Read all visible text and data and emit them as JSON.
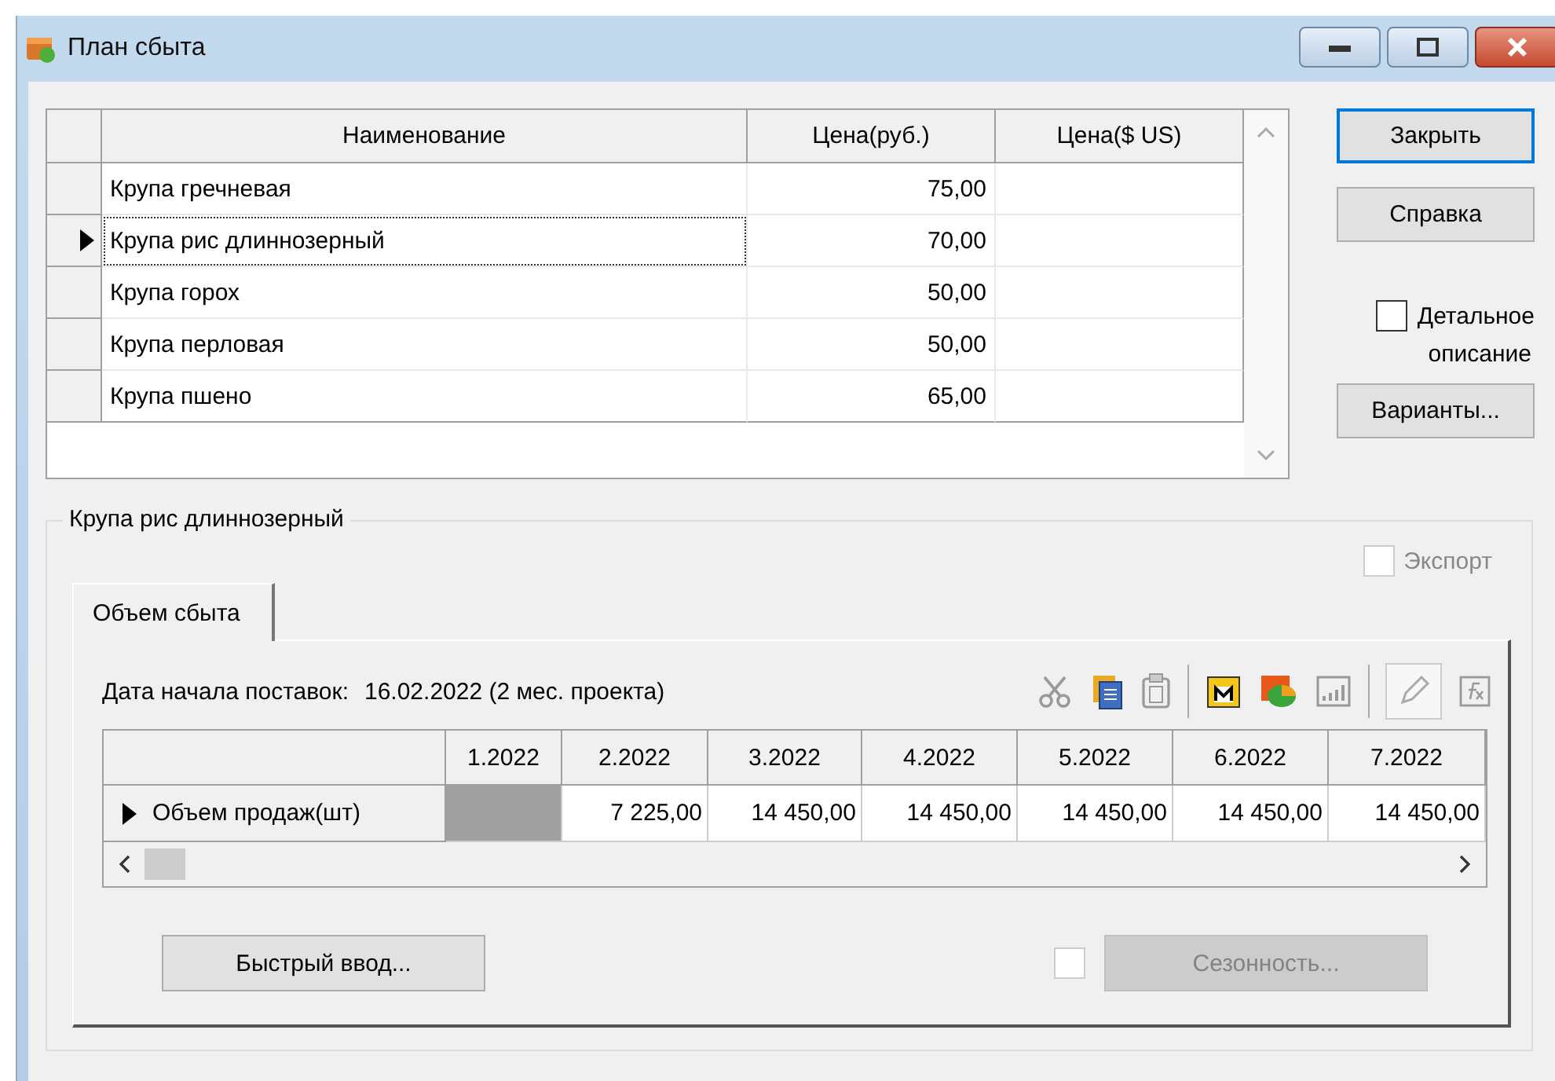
{
  "window": {
    "title": "План сбыта"
  },
  "products": {
    "columns": [
      "Наименование",
      "Цена(руб.)",
      "Цена($ US)"
    ],
    "rows": [
      {
        "name": "Крупа гречневая",
        "price_rub": "75,00",
        "selected": false
      },
      {
        "name": "Крупа рис длиннозерный",
        "price_rub": "70,00",
        "selected": true
      },
      {
        "name": "Крупа горох",
        "price_rub": "50,00",
        "selected": false
      },
      {
        "name": "Крупа перловая",
        "price_rub": "50,00",
        "selected": false
      },
      {
        "name": "Крупа пшено",
        "price_rub": "65,00",
        "selected": false
      }
    ]
  },
  "side_buttons": [
    {
      "label": "Закрыть",
      "focused": true
    },
    {
      "label": "Справка",
      "focused": false
    }
  ],
  "detail_checkbox": {
    "label_line1": "Детальное",
    "label_line2": "описание",
    "checked": false
  },
  "variants_button": {
    "label": "Варианты..."
  },
  "detail": {
    "title": "Крупа рис длиннозерный",
    "export": {
      "label": "Экспорт",
      "checked": false,
      "disabled": true
    },
    "tabs": [
      {
        "label": "Объем сбыта",
        "selected": true
      }
    ],
    "start_label": "Дата начала поставок:",
    "start_value": "16.02.2022 (2 мес. проекта)",
    "sales": {
      "columns": [
        "1.2022",
        "2.2022",
        "3.2022",
        "4.2022",
        "5.2022",
        "6.2022",
        "7.2022"
      ],
      "rows": [
        {
          "label": "Объем продаж(шт)",
          "cells": [
            {
              "kind": "blank"
            },
            {
              "kind": "value",
              "text": "7 225,00"
            },
            {
              "kind": "value",
              "text": "14 450,00"
            },
            {
              "kind": "value",
              "text": "14 450,00"
            },
            {
              "kind": "value",
              "text": "14 450,00"
            },
            {
              "kind": "value",
              "text": "14 450,00"
            },
            {
              "kind": "value",
              "text": "14 450,00"
            }
          ]
        }
      ]
    },
    "quick_button": {
      "label": "Быстрый ввод..."
    },
    "season": {
      "label": "Сезонность...",
      "checked": false,
      "disabled": true
    }
  }
}
